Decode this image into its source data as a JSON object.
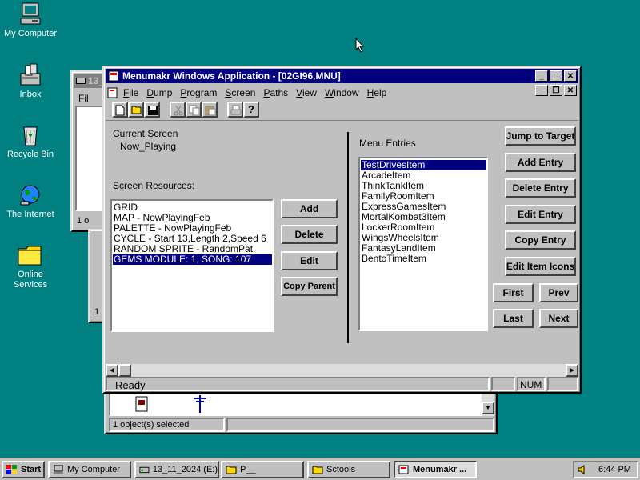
{
  "desktop": {
    "icons": [
      {
        "label": "My Computer"
      },
      {
        "label": "Inbox"
      },
      {
        "label": "Recycle Bin"
      },
      {
        "label": "The Internet"
      },
      {
        "label": "Online Services"
      }
    ]
  },
  "bg_window": {
    "title": "13_",
    "menu": "Fil",
    "status_left": "1 o",
    "status2": "1 "
  },
  "explorer": {
    "status": "1 object(s) selected"
  },
  "app": {
    "title": "Menumakr Windows Application - [02GI96.MNU]",
    "menu": [
      "File",
      "Dump",
      "Program",
      "Screen",
      "Paths",
      "View",
      "Window",
      "Help"
    ],
    "current_screen_label": "Current Screen",
    "current_screen_value": "Now_Playing",
    "screen_resources_label": "Screen Resources:",
    "resources": [
      "GRID",
      "MAP - NowPlayingFeb",
      "PALETTE - NowPlayingFeb",
      "CYCLE - Start 13,Length 2,Speed 6",
      "RANDOM SPRITE - RandomPat",
      "GEMS MODULE: 1, SONG: 107"
    ],
    "resources_selected_index": 5,
    "resource_buttons": {
      "add": "Add",
      "delete": "Delete",
      "edit": "Edit",
      "copy_parent": "Copy Parent"
    },
    "menu_entries_label": "Menu Entries",
    "entries": [
      "TestDrivesItem",
      "ArcadeItem",
      "ThinkTankItem",
      "FamilyRoomItem",
      "ExpressGamesItem",
      "MortalKombat3Item",
      "LockerRoomItem",
      "WingsWheelsItem",
      "FantasyLandItem",
      "BentoTimeItem"
    ],
    "entries_selected_index": 0,
    "entry_buttons": {
      "jump": "Jump to Target",
      "add": "Add Entry",
      "delete": "Delete Entry",
      "edit": "Edit Entry",
      "copy": "Copy Entry",
      "icons": "Edit Item Icons"
    },
    "nav_buttons": {
      "first": "First",
      "prev": "Prev",
      "last": "Last",
      "next": "Next"
    },
    "status": {
      "text": "Ready",
      "num": "NUM"
    }
  },
  "taskbar": {
    "start": "Start",
    "tasks": [
      "My Computer",
      "13_11_2024 (E:)",
      "P__",
      "Sctools",
      "Menumakr ..."
    ],
    "clock": "6:44 PM"
  }
}
